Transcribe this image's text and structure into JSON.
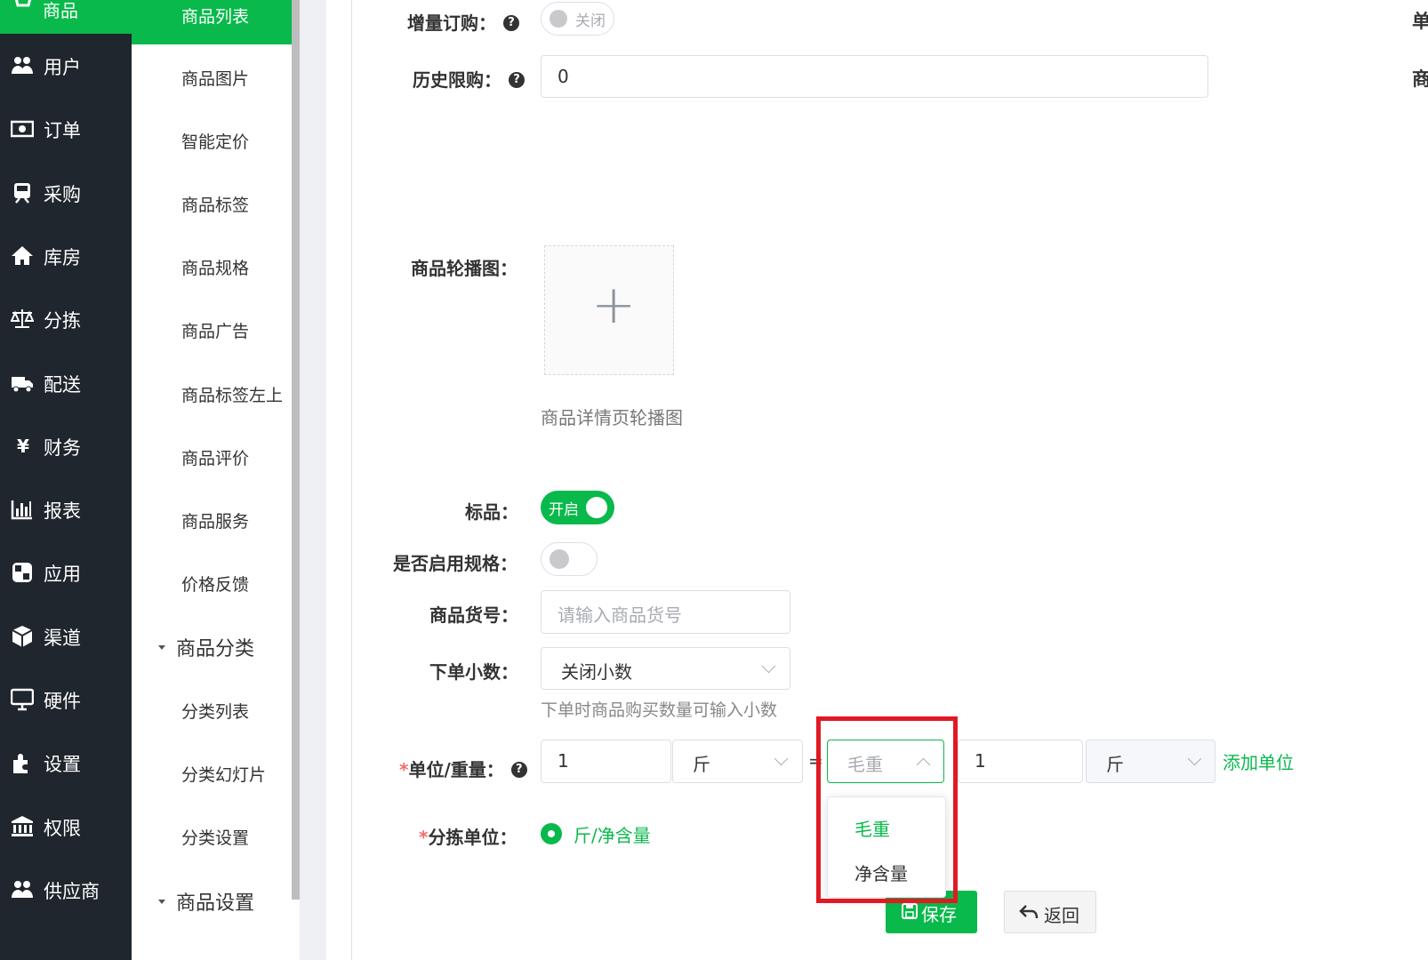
{
  "nav": {
    "active_label": "商品",
    "items": [
      {
        "label": "用户",
        "icon": "users-icon"
      },
      {
        "label": "订单",
        "icon": "money-icon"
      },
      {
        "label": "采购",
        "icon": "train-icon"
      },
      {
        "label": "库房",
        "icon": "home-icon"
      },
      {
        "label": "分拣",
        "icon": "balance-scale-icon"
      },
      {
        "label": "配送",
        "icon": "truck-icon"
      },
      {
        "label": "财务",
        "icon": "yen-icon"
      },
      {
        "label": "报表",
        "icon": "bar-chart-icon"
      },
      {
        "label": "应用",
        "icon": "apps-icon"
      },
      {
        "label": "渠道",
        "icon": "cube-icon"
      },
      {
        "label": "硬件",
        "icon": "desktop-icon"
      },
      {
        "label": "设置",
        "icon": "puzzle-icon"
      },
      {
        "label": "权限",
        "icon": "bank-icon"
      },
      {
        "label": "供应商",
        "icon": "users-icon"
      }
    ]
  },
  "subnav": {
    "active_label": "商品列表",
    "items": [
      "商品图片",
      "智能定价",
      "商品标签",
      "商品规格",
      "商品广告",
      "商品标签左上",
      "商品评价",
      "商品服务",
      "价格反馈"
    ],
    "group1": "商品分类",
    "group1_items": [
      "分类列表",
      "分类幻灯片",
      "分类设置"
    ],
    "group2": "商品设置"
  },
  "form": {
    "incremental_order": {
      "label": "增量订购：",
      "switch_text": "关闭"
    },
    "history_limit": {
      "label": "历史限购：",
      "value": "0"
    },
    "carousel": {
      "label": "商品轮播图：",
      "hint": "商品详情页轮播图",
      "plus": "+"
    },
    "standard": {
      "label": "标品：",
      "switch_text": "开启"
    },
    "enable_spec": {
      "label": "是否启用规格："
    },
    "sku": {
      "label": "商品货号：",
      "placeholder": "请输入商品货号"
    },
    "decimal": {
      "label": "下单小数：",
      "value": "关闭小数",
      "hint": "下单时商品购买数量可输入小数"
    },
    "unit_weight": {
      "required": "*",
      "label": "单位/重量：",
      "qty1": "1",
      "unit1": "斤",
      "equals": "=",
      "weight_type_placeholder": "毛重",
      "qty2": "1",
      "unit2": "斤",
      "add_unit": "添加单位",
      "dropdown_options": [
        "毛重",
        "净含量"
      ]
    },
    "sort_unit": {
      "required": "*",
      "label": "分拣单位：",
      "option": "斤/净含量"
    },
    "save_label": "保存",
    "back_label": "返回"
  },
  "right_edge": {
    "line1": "单",
    "line2": "商"
  },
  "colors": {
    "brand": "#09b94b",
    "nav_bg": "#1f262d",
    "highlight_box": "#e01a24"
  }
}
